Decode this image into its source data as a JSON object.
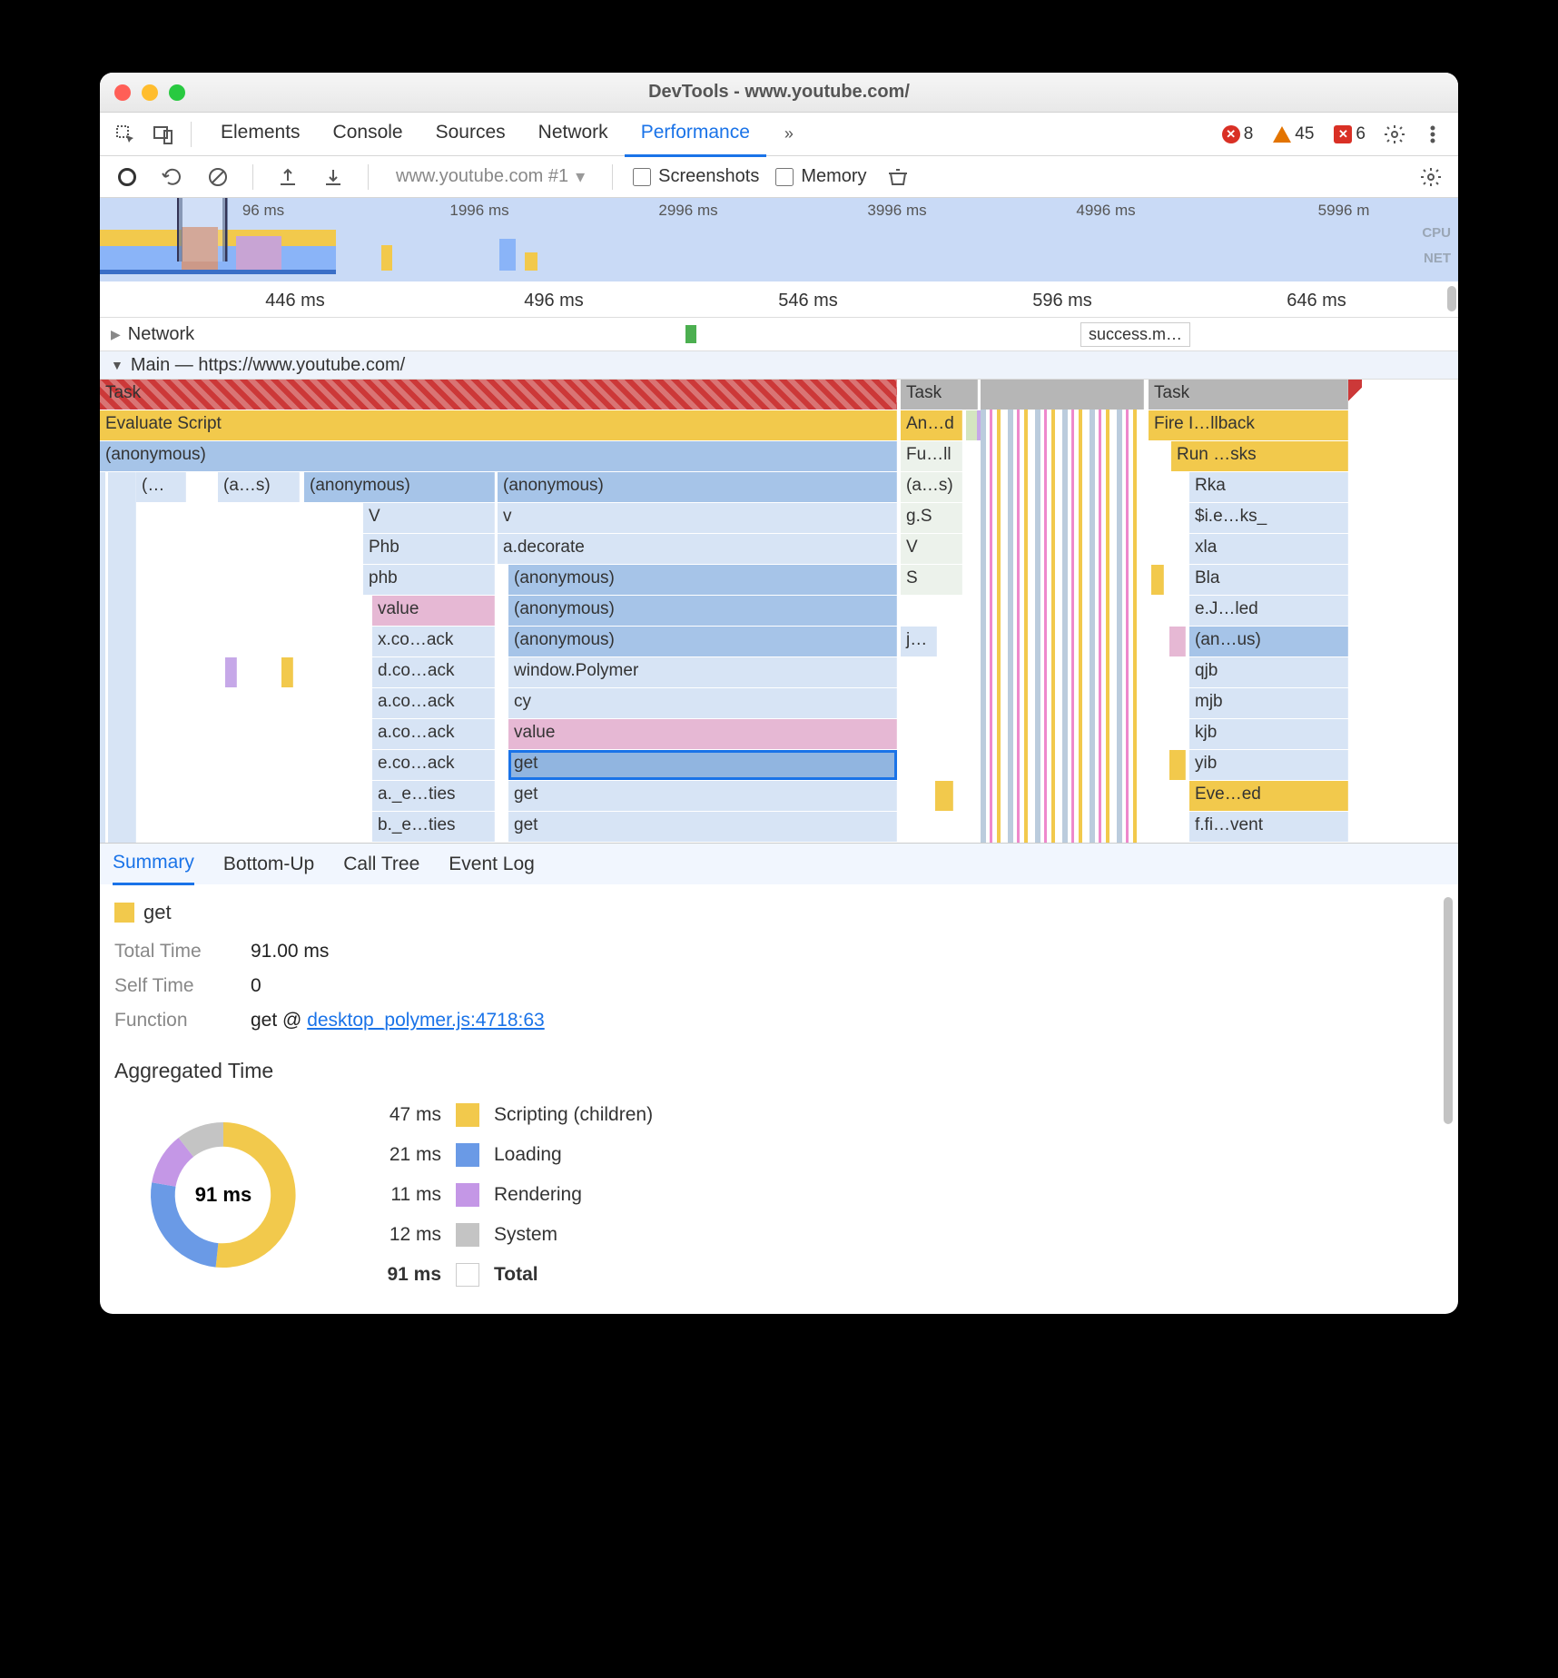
{
  "window": {
    "title": "DevTools - www.youtube.com/"
  },
  "toolbar": {
    "tabs": [
      {
        "label": "Elements",
        "active": false
      },
      {
        "label": "Console",
        "active": false
      },
      {
        "label": "Sources",
        "active": false
      },
      {
        "label": "Network",
        "active": false
      },
      {
        "label": "Performance",
        "active": true
      }
    ],
    "badges": {
      "errors": "8",
      "warnings": "45",
      "issues": "6"
    }
  },
  "perfbar": {
    "target": "www.youtube.com #1",
    "checkboxes": [
      {
        "label": "Screenshots",
        "checked": false
      },
      {
        "label": "Memory",
        "checked": false
      }
    ]
  },
  "overview": {
    "ticks": [
      "96 ms",
      "1996 ms",
      "2996 ms",
      "3996 ms",
      "4996 ms",
      "5996 m"
    ],
    "labels": [
      "CPU",
      "NET"
    ]
  },
  "ruler2": [
    "446 ms",
    "496 ms",
    "546 ms",
    "596 ms",
    "646 ms"
  ],
  "network": {
    "label": "Network",
    "tag": "success.m…"
  },
  "main": {
    "label": "Main — https://www.youtube.com/"
  },
  "flameCols": {
    "colA": {
      "task": "Task",
      "script": "Evaluate Script",
      "anon0": "(anonymous)",
      "r3a": "(…",
      "r3b": "(a…s)",
      "r3c": "(anonymous)",
      "r4": "V",
      "r5": "Phb",
      "r6": "phb",
      "r7": "value",
      "r8": "x.co…ack",
      "r9": "d.co…ack",
      "r10": "a.co…ack",
      "r11": "a.co…ack",
      "r12": "e.co…ack",
      "r13": "a._e…ties",
      "r14": "b._e…ties"
    },
    "colB": {
      "r3": "(anonymous)",
      "r4": "v",
      "r5": "a.decorate",
      "r6": "(anonymous)",
      "r7": "(anonymous)",
      "r8": "(anonymous)",
      "r9": "window.Polymer",
      "r10": "cy",
      "r11": "value",
      "r12": "get",
      "r13": "get",
      "r14": "get"
    },
    "colC": {
      "task": "Task",
      "r2": "An…d",
      "r3": "Fu…ll",
      "r4": "(a…s)",
      "r5": "g.S",
      "r6": "V",
      "r7": "S",
      "r8j": "j…"
    },
    "colD": {
      "task": "Task",
      "r2": "Fire I…llback",
      "r3": "Run …sks",
      "r4": "Rka",
      "r5": "$i.e…ks_",
      "r6": "xla",
      "r7": "Bla",
      "r8": "e.J…led",
      "r9": "(an…us)",
      "r10": "qjb",
      "r11": "mjb",
      "r12": "kjb",
      "r13": "yib",
      "r14": "Eve…ed",
      "r15": "f.fi…vent"
    }
  },
  "detailTabs": [
    "Summary",
    "Bottom-Up",
    "Call Tree",
    "Event Log"
  ],
  "summary": {
    "name": "get",
    "totalTimeLabel": "Total Time",
    "totalTime": "91.00 ms",
    "selfTimeLabel": "Self Time",
    "selfTime": "0",
    "functionLabel": "Function",
    "functionPrefix": "get @ ",
    "functionLink": "desktop_polymer.js:4718:63",
    "aggTitle": "Aggregated Time",
    "centerLabel": "91 ms",
    "legend": [
      {
        "ms": "47 ms",
        "color": "#f2c94c",
        "name": "Scripting (children)"
      },
      {
        "ms": "21 ms",
        "color": "#6a9ae6",
        "name": "Loading"
      },
      {
        "ms": "11 ms",
        "color": "#c497e6",
        "name": "Rendering"
      },
      {
        "ms": "12 ms",
        "color": "#c4c4c4",
        "name": "System"
      },
      {
        "ms": "91 ms",
        "color": "",
        "name": "Total",
        "total": true
      }
    ]
  },
  "chart_data": {
    "type": "pie",
    "title": "Aggregated Time",
    "total_ms": 91,
    "series": [
      {
        "name": "Scripting (children)",
        "value": 47,
        "color": "#f2c94c"
      },
      {
        "name": "Loading",
        "value": 21,
        "color": "#6a9ae6"
      },
      {
        "name": "Rendering",
        "value": 11,
        "color": "#c497e6"
      },
      {
        "name": "System",
        "value": 12,
        "color": "#c4c4c4"
      }
    ]
  }
}
